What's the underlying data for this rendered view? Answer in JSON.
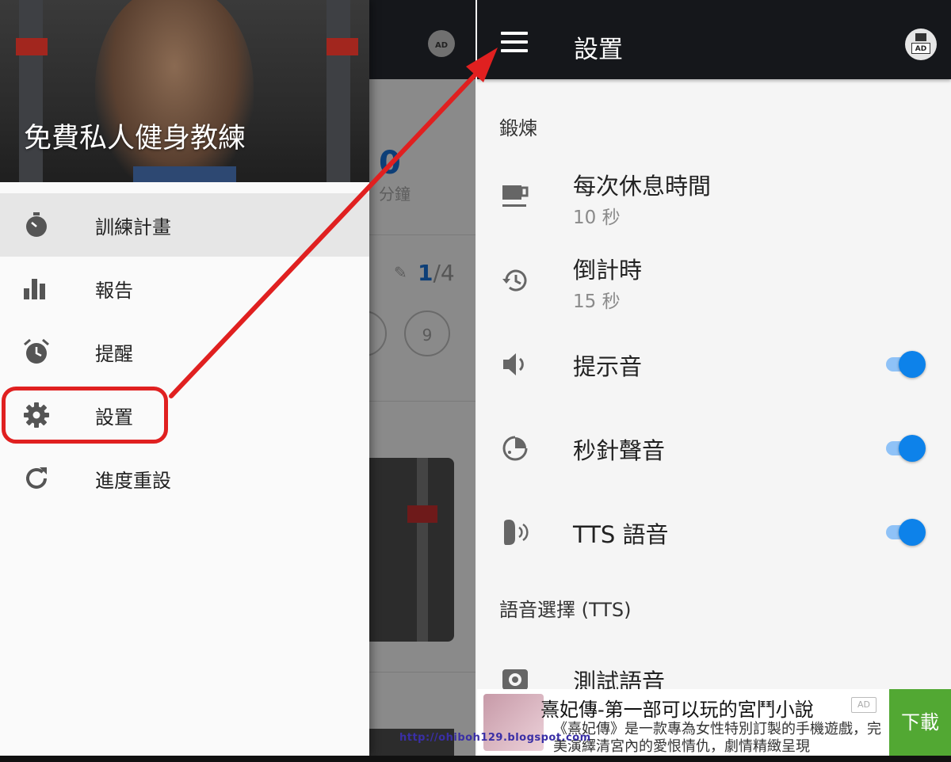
{
  "background_screen": {
    "stat_value": "0",
    "stat_unit": "分鐘",
    "progress_current": "1",
    "progress_total": "/4",
    "day_circle": "9"
  },
  "drawer": {
    "header_title": "免費私人健身教練",
    "items": [
      {
        "label": "訓練計畫",
        "icon": "stopwatch-icon",
        "active": true
      },
      {
        "label": "報告",
        "icon": "bar-chart-icon"
      },
      {
        "label": "提醒",
        "icon": "alarm-clock-icon"
      },
      {
        "label": "設置",
        "icon": "gear-icon",
        "highlighted": true
      },
      {
        "label": "進度重設",
        "icon": "refresh-icon"
      }
    ]
  },
  "settings": {
    "app_bar_title": "設置",
    "ad_badge": "AD",
    "section_workout": "鍛煉",
    "rest_time": {
      "title": "每次休息時間",
      "value": "10 秒",
      "icon": "coffee-cup-icon"
    },
    "countdown": {
      "title": "倒計時",
      "value": "15 秒",
      "icon": "history-icon"
    },
    "sound_cue": {
      "title": "提示音",
      "enabled": true,
      "icon": "speaker-icon"
    },
    "second_hand_sound": {
      "title": "秒針聲音",
      "enabled": true,
      "icon": "timer-dial-icon"
    },
    "tts_voice": {
      "title": "TTS 語音",
      "enabled": true,
      "icon": "voice-icon"
    },
    "section_voice": "語音選擇 (TTS)",
    "test_voice": {
      "title": "測試語音",
      "icon": "test-voice-icon"
    }
  },
  "ad_banner": {
    "title": "熹妃傳-第一部可以玩的宮鬥小說",
    "tag": "AD",
    "description": "《熹妃傳》是一款專為女性特別訂製的手機遊戲，完美演繹清宮內的愛恨情仇，劇情精緻呈現",
    "button": "下載",
    "watermark": "http://ohiboh129.blogspot.com"
  },
  "colors": {
    "app_bar": "#15171b",
    "toggle_on": "#0d82ea",
    "annotation_red": "#e02020",
    "ad_button": "#52a833"
  }
}
